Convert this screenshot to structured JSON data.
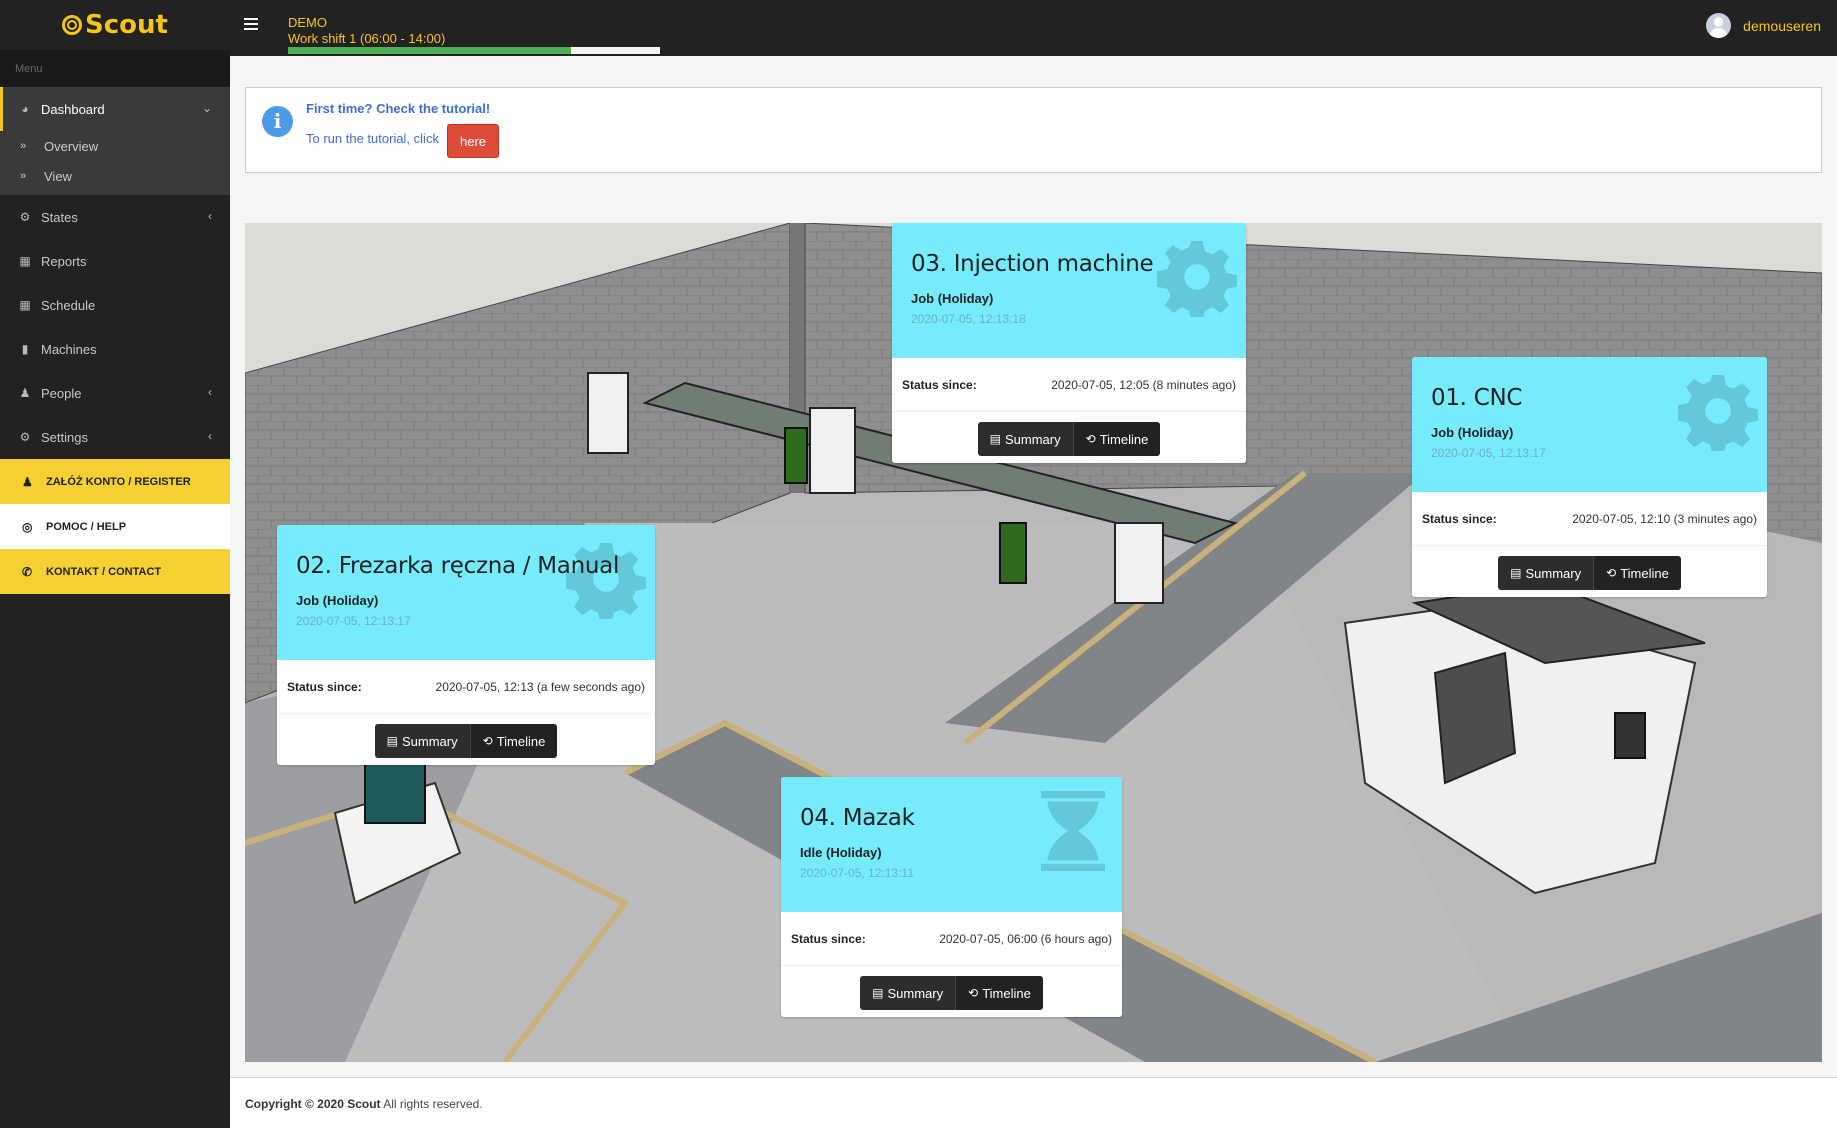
{
  "app": {
    "brand": "Scout",
    "brand_color": "#f5c518"
  },
  "topbar": {
    "env_label": "DEMO",
    "shift_label": "Work shift 1 (06:00 - 14:00)",
    "shift_progress_percent": 76,
    "username": "demouseren"
  },
  "sidebar": {
    "menu_header": "Menu",
    "items": [
      {
        "label": "Dashboard",
        "icon": "dashboard-icon",
        "expanded": true
      },
      {
        "label": "States",
        "icon": "cogs-icon"
      },
      {
        "label": "Reports",
        "icon": "table-icon"
      },
      {
        "label": "Schedule",
        "icon": "calendar-icon"
      },
      {
        "label": "Machines",
        "icon": "machine-icon"
      },
      {
        "label": "People",
        "icon": "users-icon"
      },
      {
        "label": "Settings",
        "icon": "cogs-icon"
      }
    ],
    "submenu": [
      {
        "label": "Overview"
      },
      {
        "label": "View"
      }
    ],
    "promo": [
      {
        "label": "ZAŁÓŻ KONTO / REGISTER",
        "icon": "user-plus-icon"
      },
      {
        "label": "POMOC / HELP",
        "icon": "life-ring-icon"
      },
      {
        "label": "KONTAKT / CONTACT",
        "icon": "phone-icon"
      }
    ]
  },
  "alert": {
    "title": "First time? Check the tutorial!",
    "text": "To run the tutorial, click",
    "button_label": "here"
  },
  "machines": [
    {
      "name": "03. Injection machine",
      "state": "Job (Holiday)",
      "timestamp": "2020-07-05, 12:13:18",
      "status_label": "Status since:",
      "status_since": "2020-07-05, 12:05 (8 minutes ago)",
      "icon": "gear-icon",
      "summary_label": "Summary",
      "timeline_label": "Timeline"
    },
    {
      "name": "01. CNC",
      "state": "Job (Holiday)",
      "timestamp": "2020-07-05, 12:13:17",
      "status_label": "Status since:",
      "status_since": "2020-07-05, 12:10 (3 minutes ago)",
      "icon": "gear-icon",
      "summary_label": "Summary",
      "timeline_label": "Timeline"
    },
    {
      "name": "02. Frezarka ręczna / Manual",
      "state": "Job (Holiday)",
      "timestamp": "2020-07-05, 12:13:17",
      "status_label": "Status since:",
      "status_since": "2020-07-05, 12:13 (a few seconds ago)",
      "icon": "gear-icon",
      "summary_label": "Summary",
      "timeline_label": "Timeline"
    },
    {
      "name": "04. Mazak",
      "state": "Idle (Holiday)",
      "timestamp": "2020-07-05, 12:13:11",
      "status_label": "Status since:",
      "status_since": "2020-07-05, 06:00 (6 hours ago)",
      "icon": "hourglass-icon",
      "summary_label": "Summary",
      "timeline_label": "Timeline"
    }
  ],
  "footer": {
    "copyright": "Copyright © 2020 Scout",
    "rights": "All rights reserved."
  }
}
